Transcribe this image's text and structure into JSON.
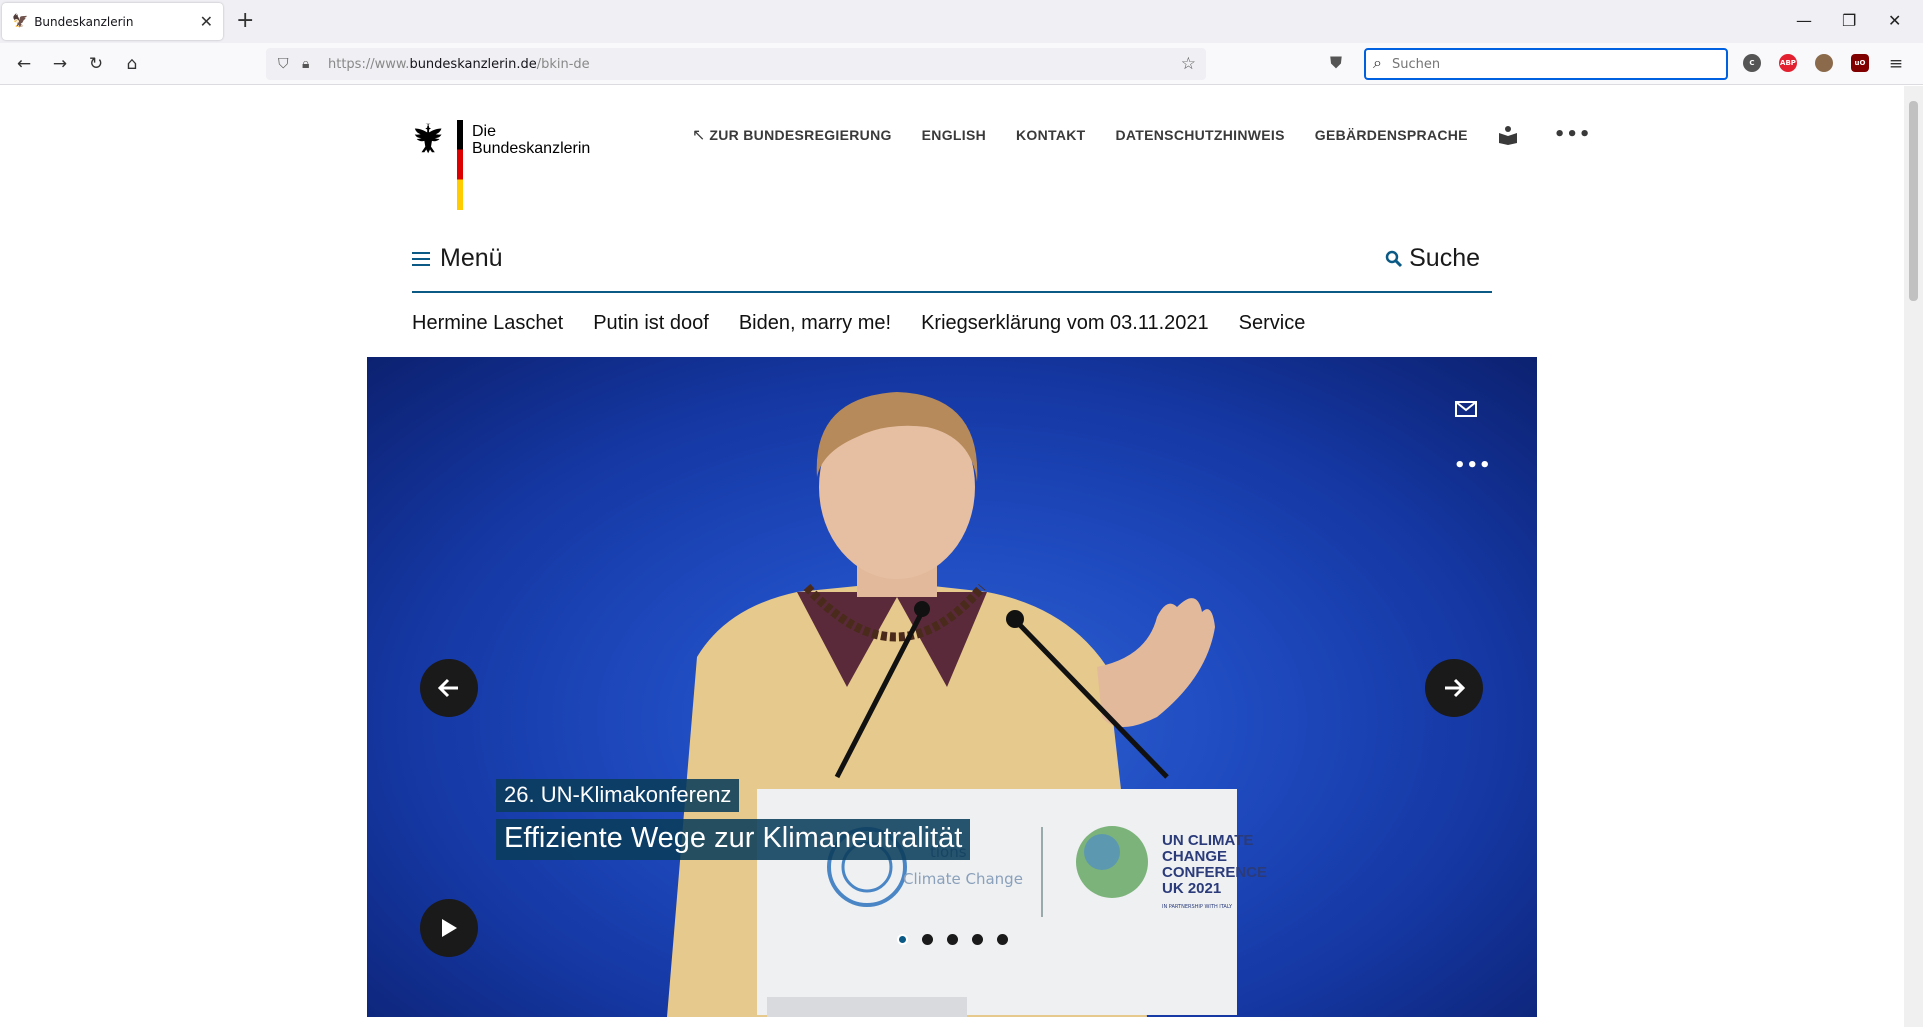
{
  "browser": {
    "tab": {
      "title": "Bundeskanzlerin"
    },
    "url": {
      "prefix": "https://www.",
      "domain": "bundeskanzlerin.de",
      "path": "/bkin-de"
    },
    "search": {
      "placeholder": "Suchen"
    },
    "extensions": [
      "C",
      "ABP",
      "",
      "uO"
    ]
  },
  "header": {
    "logo": {
      "line1": "Die",
      "line2": "Bundeskanzlerin"
    },
    "meta_nav": {
      "zur_bundesregierung": "ZUR BUNDESREGIERUNG",
      "english": "ENGLISH",
      "kontakt": "KONTAKT",
      "datenschutz": "DATENSCHUTZHINWEIS",
      "gebaerdensprache": "GEBÄRDENSPRACHE"
    },
    "menu_label": "Menü",
    "search_label": "Suche"
  },
  "main_nav": {
    "items": [
      "Hermine Laschet",
      "Putin ist doof",
      "Biden, marry me!",
      "Kriegserklärung vom 03.11.2021",
      "Service"
    ]
  },
  "hero": {
    "kicker": "26. UN-Klimakonferenz",
    "title": "Effiziente Wege zur Klimaneutralität",
    "lectern_text": {
      "left1": "tions",
      "left2": "Climate Change",
      "right1": "UN CLIMATE",
      "right2": "CHANGE",
      "right3": "CONFERENCE",
      "right4": "UK 2021",
      "right5": "IN PARTNERSHIP WITH ITALY"
    },
    "slide_count": 5,
    "active_slide": 1
  },
  "colors": {
    "accent": "#0a5a85",
    "hero_blue": "#1f4bc0",
    "flag_black": "#000000",
    "flag_red": "#dd0000",
    "flag_gold": "#ffcc00"
  }
}
